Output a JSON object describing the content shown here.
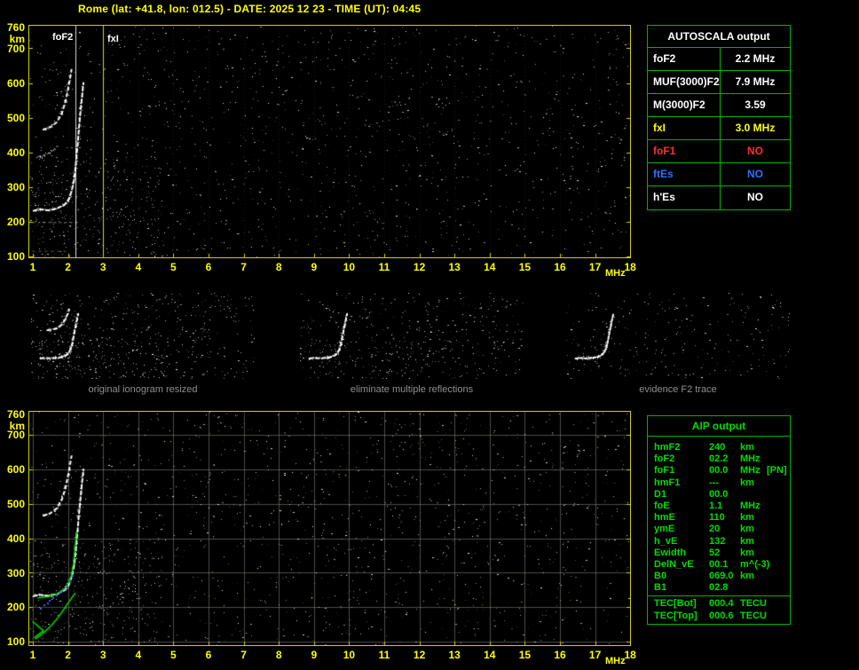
{
  "header": {
    "title": "Rome (lat: +41.8, lon: 012.5) - DATE: 2025 12 23 - TIME (UT): 04:45"
  },
  "colors": {
    "axis_yellow": "#ffff00",
    "plot_border": "#cfcf00",
    "table_green": "#00b400",
    "aip_text_green": "#00dc00",
    "caption_gray": "#8f8f8f",
    "value_red": "#ff3030",
    "value_blue": "#3070ff",
    "value_white": "#ffffff",
    "value_yellow": "#ffff00"
  },
  "axes": {
    "x_ticks": [
      "1",
      "2",
      "3",
      "4",
      "5",
      "6",
      "7",
      "8",
      "9",
      "10",
      "11",
      "12",
      "13",
      "14",
      "15",
      "16",
      "17",
      "18"
    ],
    "x_unit": "MHz",
    "y_ticks": [
      "760",
      "700",
      "600",
      "500",
      "400",
      "300",
      "200",
      "100"
    ],
    "y_unit": "km"
  },
  "top_ionogram": {
    "markers": [
      {
        "label": "foF2",
        "freq": 2.2,
        "color": "#ffffff"
      },
      {
        "label": "fxI",
        "freq": 3.0,
        "color": "#ffff00"
      }
    ],
    "traces": [
      {
        "name": "f2-trace",
        "color": "#ffffff",
        "width": 2,
        "dash": [
          4,
          3
        ],
        "sprinkle": 90,
        "pts": [
          [
            1.02,
            232
          ],
          [
            1.2,
            236
          ],
          [
            1.45,
            233
          ],
          [
            1.7,
            239
          ],
          [
            1.9,
            249
          ],
          [
            2.02,
            264
          ],
          [
            2.1,
            287
          ],
          [
            2.17,
            318
          ],
          [
            2.22,
            362
          ],
          [
            2.27,
            418
          ],
          [
            2.32,
            478
          ],
          [
            2.38,
            542
          ],
          [
            2.44,
            600
          ]
        ]
      },
      {
        "name": "second-reflection-trace",
        "color": "#ffffff",
        "width": 2,
        "dash": [
          3,
          4
        ],
        "sprinkle": 45,
        "pts": [
          [
            1.3,
            466
          ],
          [
            1.5,
            473
          ],
          [
            1.68,
            487
          ],
          [
            1.82,
            511
          ],
          [
            1.93,
            547
          ],
          [
            2.02,
            591
          ],
          [
            2.1,
            638
          ]
        ]
      },
      {
        "name": "mid-echo-segment",
        "color": "#ffffff",
        "width": 1,
        "dash": [
          2,
          4
        ],
        "alpha": 0.7,
        "sprinkle": 18,
        "pts": [
          [
            1.15,
            388
          ],
          [
            1.35,
            393
          ],
          [
            1.55,
            403
          ],
          [
            1.7,
            419
          ]
        ]
      },
      {
        "name": "interference-band-200km",
        "color": "#ffffff",
        "width": 1,
        "dash": [
          2,
          4
        ],
        "alpha": 0.5,
        "pts": [
          [
            1.0,
            198
          ],
          [
            2.3,
            198
          ]
        ]
      },
      {
        "name": "interference-band-115km",
        "color": "#ffffff",
        "width": 1,
        "dash": [
          2,
          5
        ],
        "alpha": 0.4,
        "pts": [
          [
            1.0,
            115
          ],
          [
            2.0,
            115
          ]
        ]
      }
    ]
  },
  "bottom_ionogram": {
    "traces": [
      {
        "name": "model-profile-green",
        "color": "#00dc00",
        "width": 1.5,
        "pts": [
          [
            1.08,
            108
          ],
          [
            1.25,
            121
          ],
          [
            1.45,
            139
          ],
          [
            1.65,
            161
          ],
          [
            1.85,
            189
          ],
          [
            2.0,
            212
          ],
          [
            2.1,
            226
          ],
          [
            2.17,
            236
          ],
          [
            2.2,
            240
          ]
        ]
      },
      {
        "name": "synthetic-trace-green",
        "color": "#00dc00",
        "width": 1.5,
        "pts": [
          [
            1.15,
            227
          ],
          [
            1.45,
            231
          ],
          [
            1.7,
            239
          ],
          [
            1.9,
            253
          ],
          [
            2.02,
            271
          ],
          [
            2.1,
            294
          ],
          [
            2.16,
            329
          ],
          [
            2.2,
            371
          ],
          [
            2.24,
            418
          ]
        ]
      },
      {
        "name": "corner-mark-green",
        "color": "#00dc00",
        "width": 1.5,
        "pts": [
          [
            1.0,
            158
          ],
          [
            1.3,
            132
          ],
          [
            1.05,
            112
          ]
        ]
      }
    ],
    "fitted_points": {
      "name": "fitted-f2-points-blue",
      "color": "#3c64ff",
      "pts": [
        [
          1.25,
          195
        ],
        [
          1.35,
          205
        ],
        [
          1.45,
          210
        ],
        [
          1.5,
          218
        ],
        [
          1.6,
          225
        ],
        [
          1.7,
          232
        ],
        [
          1.8,
          240
        ],
        [
          1.9,
          250
        ],
        [
          2.0,
          262
        ],
        [
          2.08,
          276
        ],
        [
          2.14,
          290
        ]
      ]
    }
  },
  "autoscala": {
    "title": "AUTOSCALA output",
    "rows": [
      {
        "label": "foF2",
        "value": "2.2 MHz",
        "color": "#ffffff"
      },
      {
        "label": "MUF(3000)F2",
        "value": "7.9 MHz",
        "color": "#ffffff"
      },
      {
        "label": "M(3000)F2",
        "value": "3.59",
        "color": "#ffffff"
      },
      {
        "label": "fxI",
        "value": "3.0 MHz",
        "color": "#ffff00"
      },
      {
        "label": "foF1",
        "value": "NO",
        "color": "#ff3030"
      },
      {
        "label": "ftEs",
        "value": "NO",
        "color": "#3070ff"
      },
      {
        "label": "h'Es",
        "value": "NO",
        "color": "#ffffff"
      }
    ]
  },
  "thumbnails": [
    {
      "caption": "original ionogram resized"
    },
    {
      "caption": "eliminate multiple reflections"
    },
    {
      "caption": "evidence F2 trace"
    }
  ],
  "aip": {
    "title": "AIP output",
    "rows": [
      {
        "label": "hmF2",
        "value": "240",
        "unit": "km",
        "note": ""
      },
      {
        "label": "foF2",
        "value": "02.2",
        "unit": "MHz",
        "note": ""
      },
      {
        "label": "foF1",
        "value": "00.0",
        "unit": "MHz",
        "note": "[PN]"
      },
      {
        "label": "hmF1",
        "value": "---",
        "unit": "km",
        "note": ""
      },
      {
        "label": "D1",
        "value": "00.0",
        "unit": "",
        "note": ""
      },
      {
        "label": "foE",
        "value": "1.1",
        "unit": "MHz",
        "note": ""
      },
      {
        "label": "hmE",
        "value": "110",
        "unit": "km",
        "note": ""
      },
      {
        "label": "ymE",
        "value": "20",
        "unit": "km",
        "note": ""
      },
      {
        "label": "h_vE",
        "value": "132",
        "unit": "km",
        "note": ""
      },
      {
        "label": "Ewidth",
        "value": "52",
        "unit": "km",
        "note": ""
      },
      {
        "label": "DelN_vE",
        "value": "00.1",
        "unit": "m^(-3)",
        "note": ""
      },
      {
        "label": "B0",
        "value": "069.0",
        "unit": "km",
        "note": ""
      },
      {
        "label": "B1",
        "value": "02.8",
        "unit": "",
        "note": ""
      }
    ],
    "tec_rows": [
      {
        "label": "TEC[Bot]",
        "value": "000.4",
        "unit": "TECU"
      },
      {
        "label": "TEC[Top]",
        "value": "000.6",
        "unit": "TECU"
      }
    ]
  }
}
